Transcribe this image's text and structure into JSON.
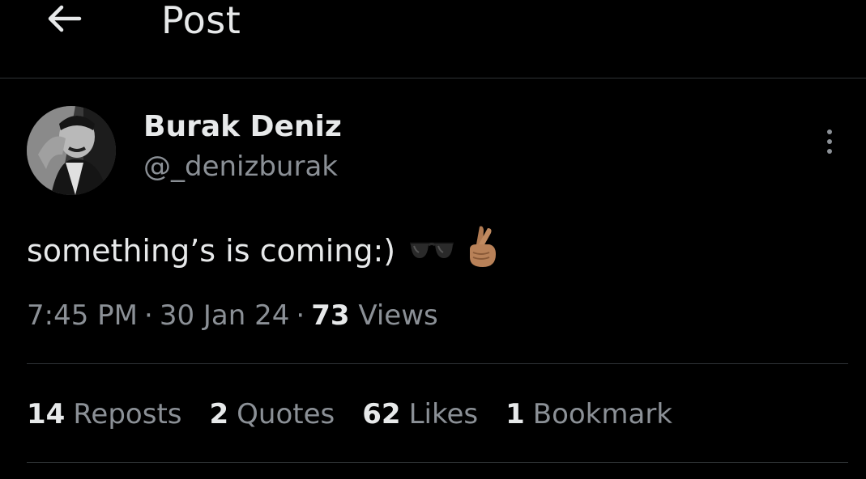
{
  "header": {
    "back_icon": "arrow-left-icon",
    "title": "Post"
  },
  "author": {
    "display_name": "Burak Deniz",
    "handle": "@_denizburak",
    "avatar_icon": "profile-photo"
  },
  "post": {
    "text": "something’s is coming:)",
    "emojis": [
      "sunglasses-emoji",
      "crossed-fingers-emoji"
    ]
  },
  "meta": {
    "time": "7:45 PM",
    "separator": "·",
    "date": "30 Jan 24",
    "views_count": "73",
    "views_label": "Views"
  },
  "stats": [
    {
      "count": "14",
      "label": "Reposts"
    },
    {
      "count": "2",
      "label": "Quotes"
    },
    {
      "count": "62",
      "label": "Likes"
    },
    {
      "count": "1",
      "label": "Bookmark"
    }
  ],
  "colors": {
    "background": "#000000",
    "primary_text": "#e7e9ea",
    "secondary_text": "#8b9096",
    "divider": "#2f3336"
  }
}
